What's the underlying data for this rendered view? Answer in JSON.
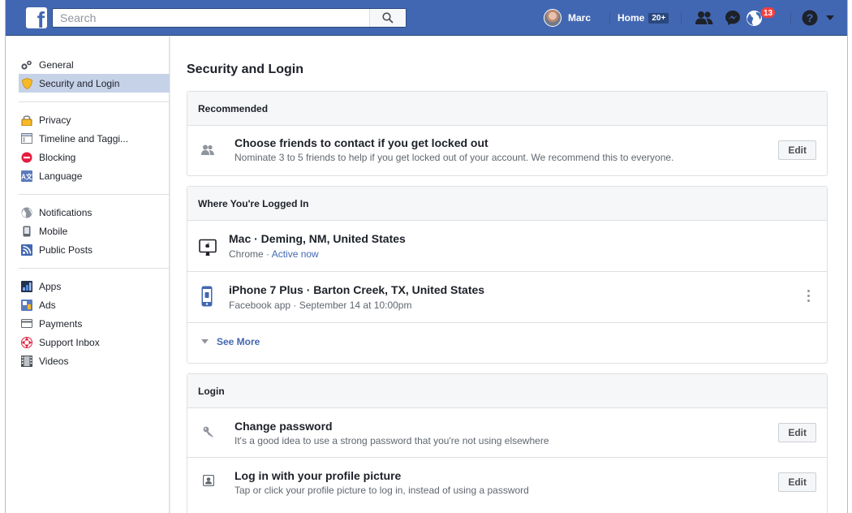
{
  "topbar": {
    "logo": "f",
    "search_placeholder": "Search",
    "user_name": "Marc",
    "home_label": "Home",
    "home_badge": "20+",
    "notifications_count": "13",
    "icons": [
      "friend-requests-icon",
      "messenger-icon",
      "notifications-globe-icon",
      "help-icon",
      "caret-down-icon"
    ]
  },
  "sidebar": {
    "groups": [
      [
        {
          "label": "General",
          "icon": "gears-icon"
        },
        {
          "label": "Security and Login",
          "icon": "shield-icon",
          "active": true
        }
      ],
      [
        {
          "label": "Privacy",
          "icon": "lock-icon"
        },
        {
          "label": "Timeline and Taggi...",
          "icon": "timeline-icon"
        },
        {
          "label": "Blocking",
          "icon": "blocking-icon"
        },
        {
          "label": "Language",
          "icon": "language-icon"
        }
      ],
      [
        {
          "label": "Notifications",
          "icon": "globe-icon"
        },
        {
          "label": "Mobile",
          "icon": "mobile-icon"
        },
        {
          "label": "Public Posts",
          "icon": "rss-icon"
        }
      ],
      [
        {
          "label": "Apps",
          "icon": "apps-icon"
        },
        {
          "label": "Ads",
          "icon": "ads-icon"
        },
        {
          "label": "Payments",
          "icon": "payments-icon"
        },
        {
          "label": "Support Inbox",
          "icon": "support-icon"
        },
        {
          "label": "Videos",
          "icon": "film-icon"
        }
      ]
    ]
  },
  "main": {
    "title": "Security and Login",
    "recommended": {
      "header": "Recommended",
      "title": "Choose friends to contact if you get locked out",
      "subtitle": "Nominate 3 to 5 friends to help if you get locked out of your account. We recommend this to everyone.",
      "button": "Edit"
    },
    "logged_in": {
      "header": "Where You're Logged In",
      "sessions": [
        {
          "device": "Mac · Deming, NM, United States",
          "app": "Chrome · ",
          "status": "Active now"
        },
        {
          "device": "iPhone 7 Plus · Barton Creek, TX, United States",
          "app": "Facebook app · September 14 at 10:00pm",
          "status": ""
        }
      ],
      "see_more": "See More"
    },
    "login": {
      "header": "Login",
      "items": [
        {
          "title": "Change password",
          "subtitle": "It's a good idea to use a strong password that you're not using elsewhere",
          "button": "Edit"
        },
        {
          "title": "Log in with your profile picture",
          "subtitle": "Tap or click your profile picture to log in, instead of using a password",
          "button": "Edit"
        }
      ]
    }
  },
  "colors": {
    "brand": "#4267b2",
    "link": "#4267b2",
    "active_sidebar": "#c6d2e8",
    "badge": "#fa3e3e"
  }
}
